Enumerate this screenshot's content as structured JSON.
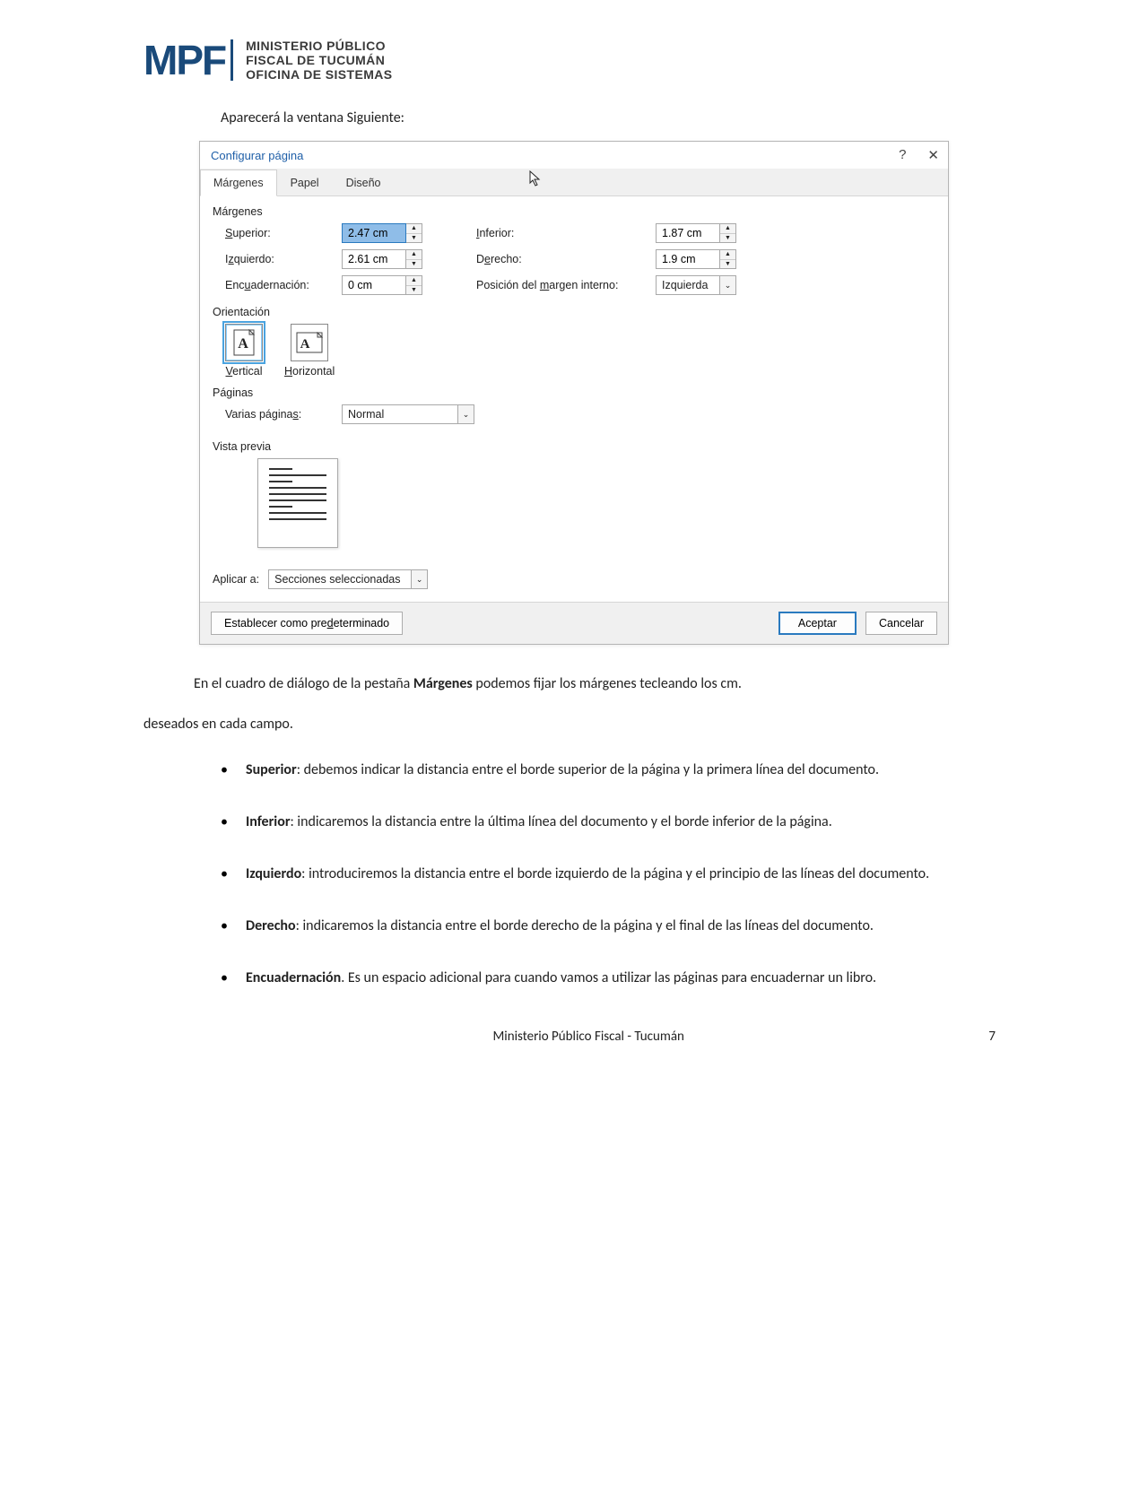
{
  "logo": {
    "abbrev": "MPF",
    "line1": "MINISTERIO PÚBLICO",
    "line2": "FISCAL DE TUCUMÁN",
    "line3": "OFICINA DE SISTEMAS"
  },
  "intro": "Aparecerá la ventana Siguiente:",
  "dialog": {
    "title": "Configurar página",
    "help": "?",
    "close": "✕",
    "tabs": [
      "Márgenes",
      "Papel",
      "Diseño"
    ],
    "sections": {
      "margins_label": "Márgenes",
      "orientation_label": "Orientación",
      "pages_label": "Páginas",
      "preview_label": "Vista previa"
    },
    "fields": {
      "superior_label": "Superior:",
      "superior_value": "2.47 cm",
      "inferior_label": "Inferior:",
      "inferior_value": "1.87 cm",
      "izquierdo_label": "Izquierdo:",
      "izquierdo_value": "2.61 cm",
      "derecho_label": "Derecho:",
      "derecho_value": "1.9 cm",
      "encuad_label": "Encuadernación:",
      "encuad_value": "0 cm",
      "posicion_label": "Posición del margen interno:",
      "posicion_value": "Izquierda"
    },
    "orientation": {
      "vertical": "Vertical",
      "horizontal": "Horizontal"
    },
    "pages": {
      "varias_label": "Varias páginas:",
      "varias_value": "Normal"
    },
    "apply": {
      "label": "Aplicar a:",
      "value": "Secciones seleccionadas"
    },
    "footer": {
      "default_btn": "Establecer como predeterminado",
      "accept_btn": "Aceptar",
      "cancel_btn": "Cancelar"
    }
  },
  "para1_pre": "En el cuadro de diálogo de la pestaña ",
  "para1_bold": "Márgenes",
  "para1_post": " podemos fijar los márgenes tecleando los cm.",
  "para2": "deseados en cada campo.",
  "bullets": [
    {
      "b": "Superior",
      "t": ": debemos indicar la distancia entre el borde superior de la página y la primera línea del documento."
    },
    {
      "b": "Inferior",
      "t": ": indicaremos la distancia entre la última línea del documento y el borde inferior de la página."
    },
    {
      "b": "Izquierdo",
      "t": ": introduciremos la distancia entre el borde izquierdo de la página y el principio de las líneas del documento."
    },
    {
      "b": "Derecho",
      "t": ": indicaremos la distancia entre el borde derecho de la página y el final de las líneas del documento."
    },
    {
      "b": "Encuadernación",
      "t": ". Es un espacio adicional para cuando vamos a utilizar las páginas para encuadernar un libro."
    }
  ],
  "footer": {
    "center": "Ministerio Público Fiscal - Tucumán",
    "page": "7"
  }
}
